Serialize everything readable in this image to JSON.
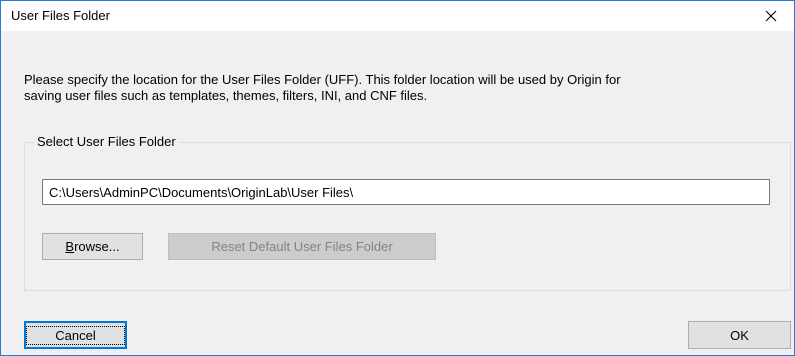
{
  "window": {
    "title": "User Files Folder",
    "close_icon": "close-icon"
  },
  "description": {
    "line1": "Please specify the location for the User Files Folder (UFF). This folder location will be used by Origin for",
    "line2": "saving user files such as templates, themes, filters, INI, and CNF files."
  },
  "group": {
    "label": "Select User Files Folder",
    "path_value": "C:\\Users\\AdminPC\\Documents\\OriginLab\\User Files\\",
    "browse_mnemonic": "B",
    "browse_rest": "rowse...",
    "reset_label": "Reset Default User Files Folder"
  },
  "footer": {
    "cancel_label": "Cancel",
    "ok_label": "OK"
  },
  "colors": {
    "window_border": "#2b79d6",
    "dialog_bg": "#f0f0f0",
    "focus_accent": "#0078d7"
  }
}
